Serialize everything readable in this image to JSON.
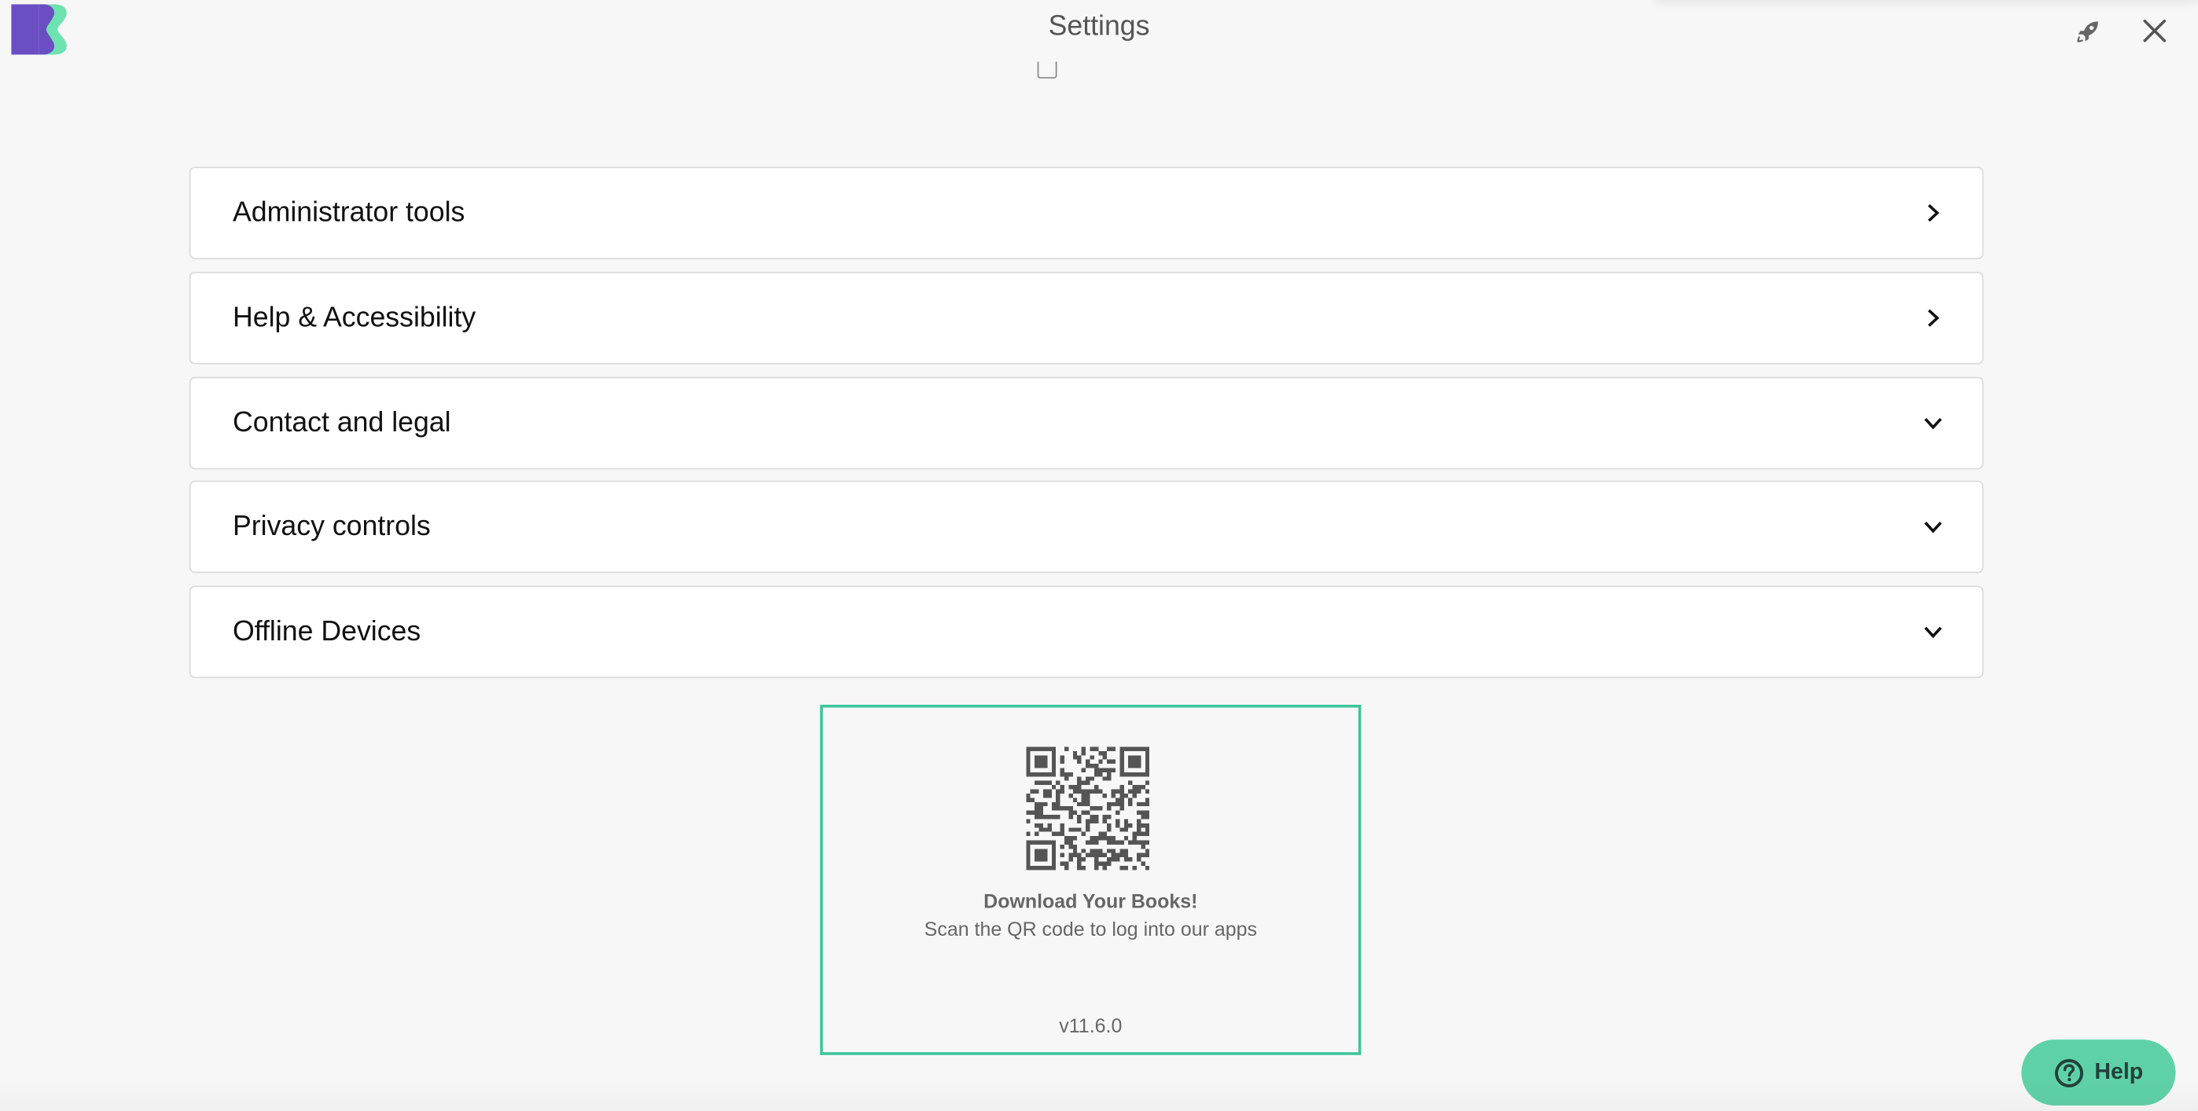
{
  "header": {
    "title": "Settings"
  },
  "sections": [
    {
      "label": "Administrator tools",
      "chevron": "chevron-right-icon"
    },
    {
      "label": "Help & Accessibility",
      "chevron": "chevron-right-icon"
    },
    {
      "label": "Contact and legal",
      "chevron": "chevron-down-icon"
    },
    {
      "label": "Privacy controls",
      "chevron": "chevron-down-icon"
    },
    {
      "label": "Offline Devices",
      "chevron": "chevron-down-icon"
    }
  ],
  "qr_card": {
    "title": "Download Your Books!",
    "subtitle": "Scan the QR code to log into our apps",
    "version": "v11.6.0"
  },
  "help_button": {
    "label": "Help"
  },
  "colors": {
    "accent": "#3cc59b",
    "help_bg": "#5fd1a8",
    "logo_purple": "#6a4fc2",
    "logo_green": "#6ee2b0",
    "background": "#f7f7f7"
  }
}
